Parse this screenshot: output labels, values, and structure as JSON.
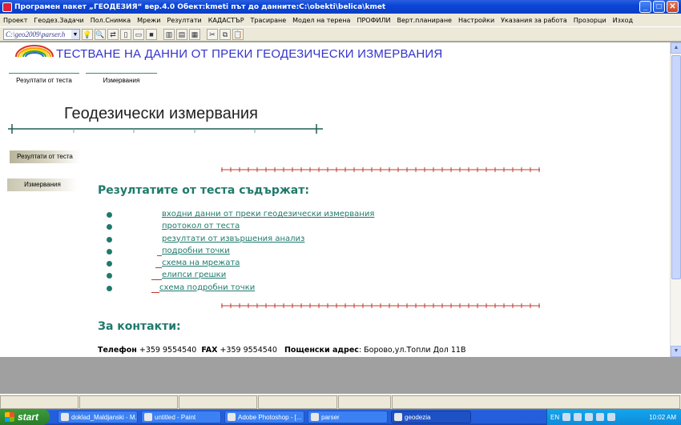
{
  "window": {
    "title": "Програмен пакет „ГЕОДЕЗИЯ“ вер.4.0     Обект:kmeti    път до данните:C:\\obekti\\belica\\kmet",
    "controls": {
      "minimize": "_",
      "maximize": "□",
      "close": "✕"
    }
  },
  "menu": [
    "Проект",
    "Геодез.Задачи",
    "Пол.Снимка",
    "Мрежи",
    "Резултати",
    "КАДАСТЪР",
    "Трасиране",
    "Модел на терена",
    "ПРОФИЛИ",
    "Верт.планиране",
    "Настройки",
    "Указания за работа",
    "Прозорци",
    "Изход"
  ],
  "toolbar": {
    "address": "C:\\geo2009\\parser.h",
    "icons": [
      "bulb-icon",
      "magnifier-icon",
      "nav-icon",
      "new-file-icon",
      "open-folder-icon",
      "stop-icon",
      "panel-icon",
      "panel-icon-2",
      "panel-icon-3",
      "cut-icon",
      "copy-icon",
      "paste-icon"
    ]
  },
  "page": {
    "header_title": "ТЕСТВАНЕ НА ДАННИ ОТ ПРЕКИ ГЕОДЕЗИЧЕСКИ ИЗМЕРВАНИЯ",
    "tabs": [
      "Резултати от теста",
      "Измервания"
    ],
    "section_title": "Геодезически измервания",
    "sidebar": [
      "Резултати от теста",
      "Измервания"
    ],
    "results_heading": "Резултатите от теста съдържат:",
    "links": [
      "входни данни от преки геодезически измервания",
      "протокол от теста",
      "резултати от извършения анализ",
      "подробни точки",
      "схема на мрежата",
      "елипси грешки",
      "схема подробни точки"
    ],
    "contacts_heading": "За контакти:",
    "contacts": {
      "phone_label": "Телефон",
      "phone": "+359 9554540",
      "fax_label": "FAX",
      "fax": "+359 9554540",
      "address_label": "Пощенски адрес",
      "address": ": Борово,ул.Топли Дол 11В"
    }
  },
  "taskbar": {
    "start": "start",
    "tasks": [
      "doklad_Maldjanski - M...",
      "untitled - Paint",
      "Adobe Photoshop - [...",
      "parser",
      "geodezia"
    ],
    "active_task": "geodezia",
    "language": "EN",
    "clock": "10:02 AM"
  },
  "colors": {
    "accent": "#1f7a6b",
    "header_blue": "#3333cc",
    "ruler_red": "#c0392b",
    "titlebar": "#0b45d6"
  }
}
